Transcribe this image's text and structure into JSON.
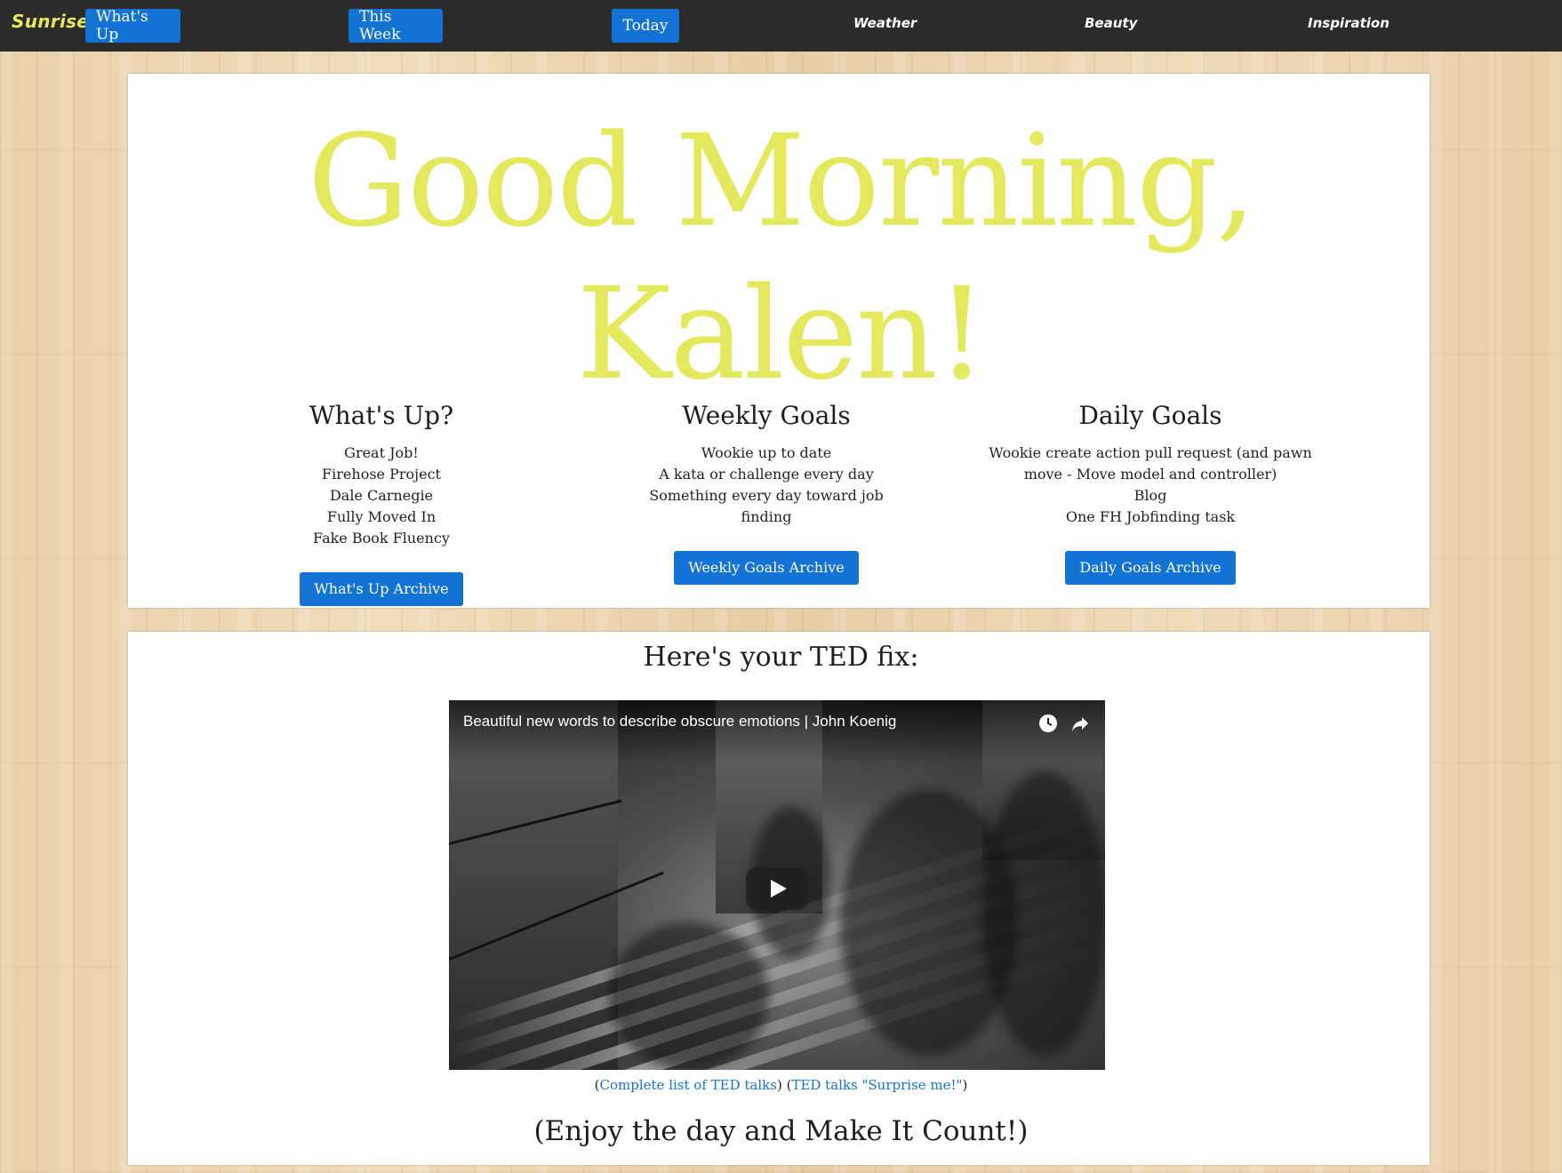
{
  "nav": {
    "brand": "Sunrise",
    "buttons": [
      "What's Up",
      "This Week",
      "Today"
    ],
    "links": [
      "Weather",
      "Beauty",
      "Inspiration"
    ]
  },
  "greeting": {
    "line1": "Good Morning,",
    "line2": "Kalen!",
    "color": "#e3e85c"
  },
  "columns": {
    "whats_up": {
      "heading": "What's Up?",
      "items": [
        "Great Job!",
        "Firehose Project",
        "Dale Carnegie",
        "Fully Moved In",
        "Fake Book Fluency"
      ],
      "button": "What's Up Archive"
    },
    "weekly": {
      "heading": "Weekly Goals",
      "items": [
        "Wookie up to date",
        "A kata or challenge every day",
        "Something every day toward job finding"
      ],
      "button": "Weekly Goals Archive"
    },
    "daily": {
      "heading": "Daily Goals",
      "items": [
        "Wookie create action pull request (and pawn move - Move model and controller)",
        "Blog",
        "One FH Jobfinding task"
      ],
      "button": "Daily Goals Archive"
    }
  },
  "ted": {
    "heading": "Here's your TED fix:",
    "video_title": "Beautiful new words to describe obscure emotions | John Koenig",
    "icons": [
      "watch-later-icon",
      "share-icon",
      "play-icon"
    ],
    "link_open_1": "(",
    "link_complete": "Complete list of TED talks",
    "link_mid": ") (",
    "link_surprise": "TED talks \"Surprise me!\"",
    "link_close": ")",
    "closing": "(Enjoy the day and Make It Count!)"
  },
  "colors": {
    "nav_bg": "#2b2b2b",
    "button_blue": "#1273d4",
    "brand_yellow": "#e6e85c"
  }
}
